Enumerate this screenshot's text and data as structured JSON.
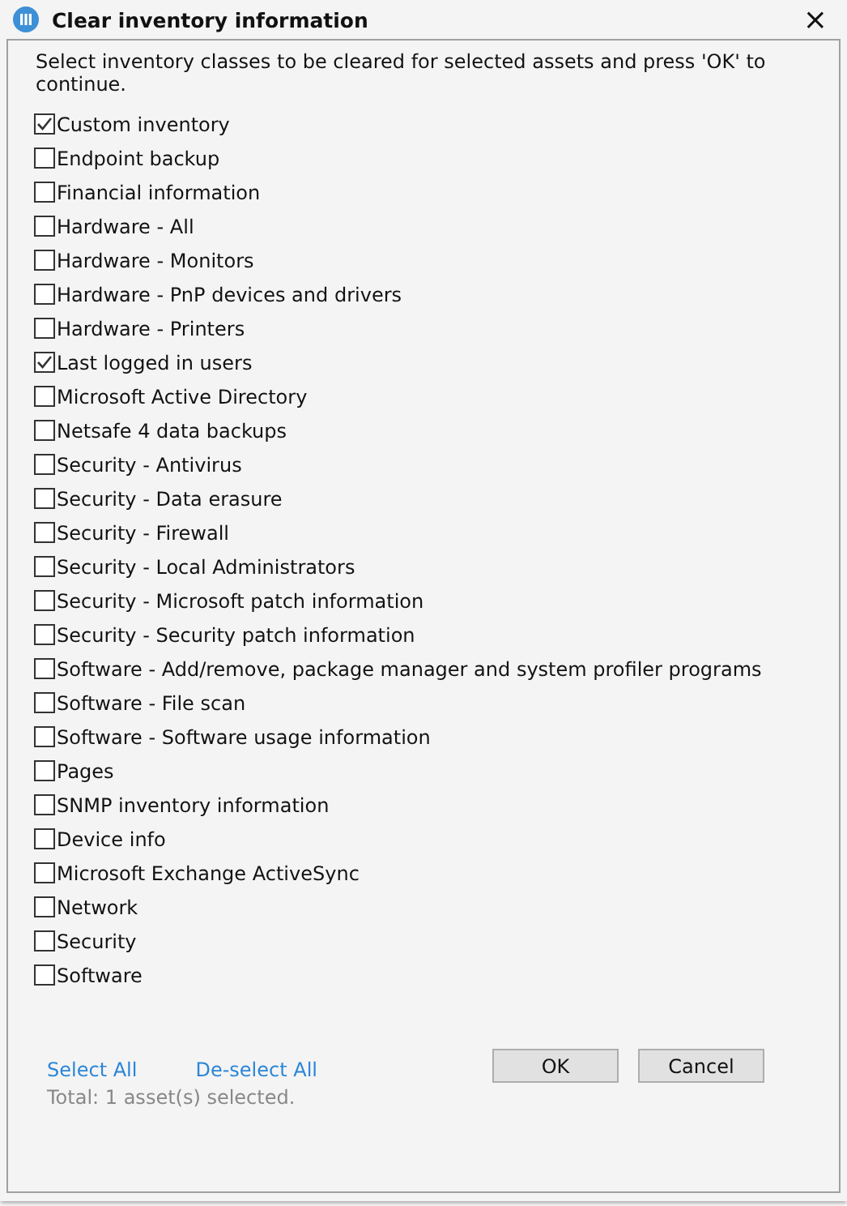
{
  "window": {
    "title": "Clear inventory information",
    "close": "×"
  },
  "instruction": "Select inventory classes to be cleared for selected assets and press 'OK' to continue.",
  "classes": [
    {
      "label": "Custom inventory",
      "checked": true
    },
    {
      "label": "Endpoint backup",
      "checked": false
    },
    {
      "label": "Financial information",
      "checked": false
    },
    {
      "label": "Hardware - All",
      "checked": false
    },
    {
      "label": "Hardware - Monitors",
      "checked": false
    },
    {
      "label": "Hardware - PnP devices and drivers",
      "checked": false
    },
    {
      "label": "Hardware - Printers",
      "checked": false
    },
    {
      "label": "Last logged in users",
      "checked": true
    },
    {
      "label": "Microsoft Active Directory",
      "checked": false
    },
    {
      "label": "Netsafe 4 data backups",
      "checked": false
    },
    {
      "label": "Security - Antivirus",
      "checked": false
    },
    {
      "label": "Security - Data erasure",
      "checked": false
    },
    {
      "label": "Security - Firewall",
      "checked": false
    },
    {
      "label": "Security - Local Administrators",
      "checked": false
    },
    {
      "label": "Security - Microsoft patch information",
      "checked": false
    },
    {
      "label": "Security - Security patch information",
      "checked": false
    },
    {
      "label": "Software - Add/remove, package manager and system profiler programs",
      "checked": false
    },
    {
      "label": "Software - File scan",
      "checked": false
    },
    {
      "label": "Software - Software usage information",
      "checked": false
    },
    {
      "label": "Pages",
      "checked": false
    },
    {
      "label": "SNMP inventory information",
      "checked": false
    },
    {
      "label": "Device info",
      "checked": false
    },
    {
      "label": "Microsoft Exchange ActiveSync",
      "checked": false
    },
    {
      "label": "Network",
      "checked": false
    },
    {
      "label": "Security",
      "checked": false
    },
    {
      "label": "Software",
      "checked": false
    }
  ],
  "links": [
    "Select All",
    "De-select All"
  ],
  "total": "Total: 1 asset(s) selected.",
  "buttons": [
    "OK",
    "Cancel"
  ]
}
